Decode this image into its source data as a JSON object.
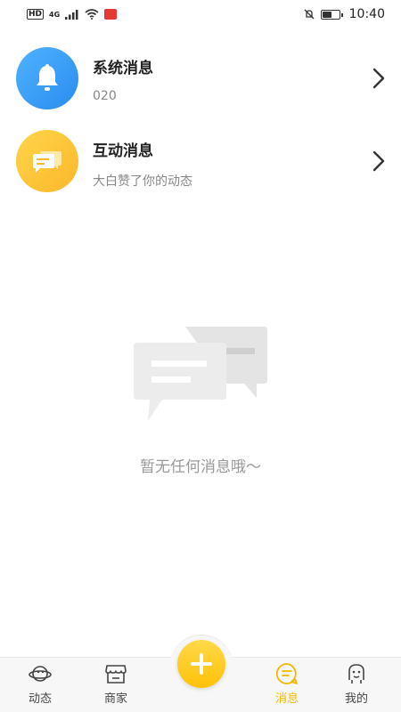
{
  "status_bar": {
    "hd": "HD",
    "network": "4G",
    "time": "10:40",
    "battery_level": 0.55
  },
  "messages": [
    {
      "title": "系统消息",
      "subtitle": "020",
      "icon": "bell-icon",
      "color": "#2a8cef"
    },
    {
      "title": "互动消息",
      "subtitle": "大白赞了你的动态",
      "icon": "chat-bubble-icon",
      "color": "#fbb72a"
    }
  ],
  "empty_state": {
    "text": "暂无任何消息哦～"
  },
  "tab_bar": {
    "tabs": [
      {
        "label": "动态",
        "icon": "planet-icon",
        "active": false
      },
      {
        "label": "商家",
        "icon": "store-icon",
        "active": false
      },
      {
        "label": "消息",
        "icon": "message-icon",
        "active": true
      },
      {
        "label": "我的",
        "icon": "face-icon",
        "active": false
      }
    ],
    "fab_icon": "plus-icon",
    "accent": "#f5b800"
  }
}
